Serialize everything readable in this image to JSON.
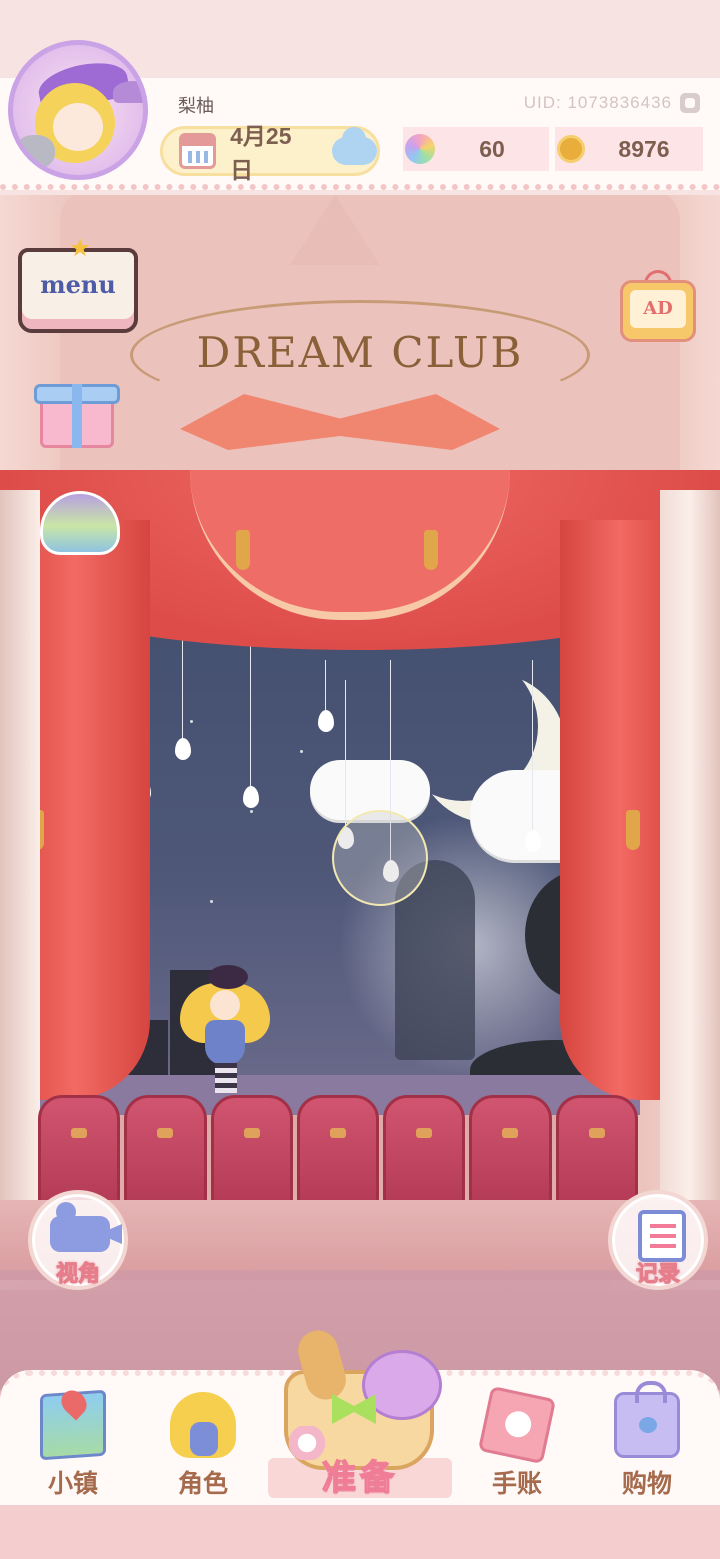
{
  "header": {
    "username": "梨柚",
    "uid": "UID: 1073836436",
    "date": "4月25日",
    "gems": "60",
    "coins": "8976"
  },
  "stage": {
    "sign_text": "DREAM CLUB"
  },
  "side_buttons": {
    "menu_label": "menu",
    "ad_label": "AD",
    "view_label": "视角",
    "record_label": "记录"
  },
  "bottom_nav": {
    "town": "小镇",
    "character": "角色",
    "prepare": "准备",
    "journal": "手账",
    "shop": "购物"
  },
  "icons": [
    "copy-icon",
    "calendar-icon",
    "weather-icon",
    "gem-icon",
    "coin-icon",
    "gift-icon",
    "scenery-icon",
    "camera-icon",
    "notebook-icon",
    "map-icon",
    "character-icon",
    "basket-icon",
    "journal-icon",
    "shop-bag-icon"
  ],
  "colors": {
    "accent_pink": "#ef7d96",
    "text_brown": "#a66a4c",
    "curtain_red": "#dd4c49"
  }
}
